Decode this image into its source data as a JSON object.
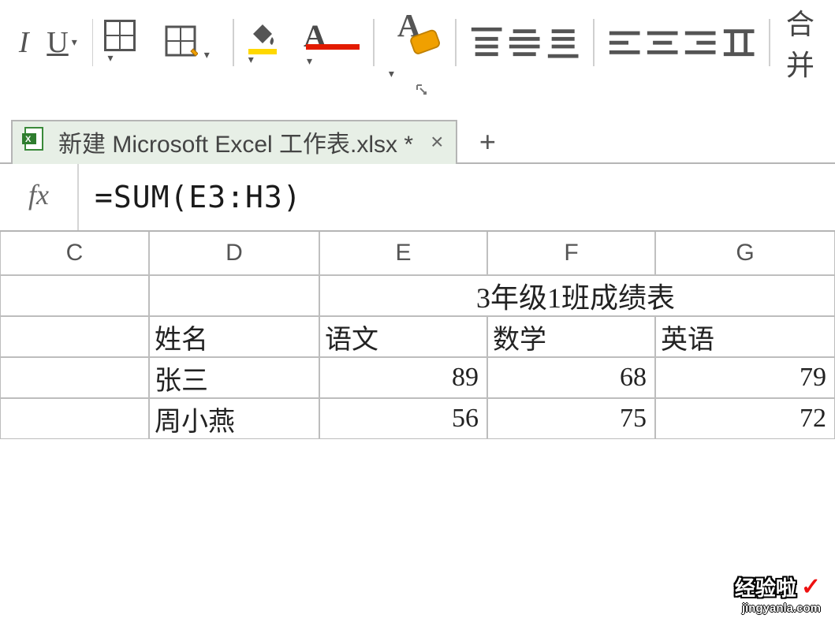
{
  "toolbar": {
    "merge_label": "合并",
    "icons": {
      "italic": "I",
      "underline": "U",
      "font_color_letter": "A"
    }
  },
  "tab": {
    "title": "新建 Microsoft Excel 工作表.xlsx *"
  },
  "formula_bar": {
    "fx_label": "fx",
    "formula": "=SUM(E3:H3)"
  },
  "columns": [
    "C",
    "D",
    "E",
    "F",
    "G"
  ],
  "sheet": {
    "title": "3年级1班成绩表",
    "headers": {
      "name": "姓名",
      "chinese": "语文",
      "math": "数学",
      "english": "英语"
    },
    "rows": [
      {
        "name": "张三",
        "chinese": "89",
        "math": "68",
        "english": "79"
      },
      {
        "name": "周小燕",
        "chinese": "56",
        "math": "75",
        "english": "72"
      }
    ]
  },
  "watermark": {
    "line1": "经验啦",
    "check": "✓",
    "line2": "jingyanla.com"
  }
}
